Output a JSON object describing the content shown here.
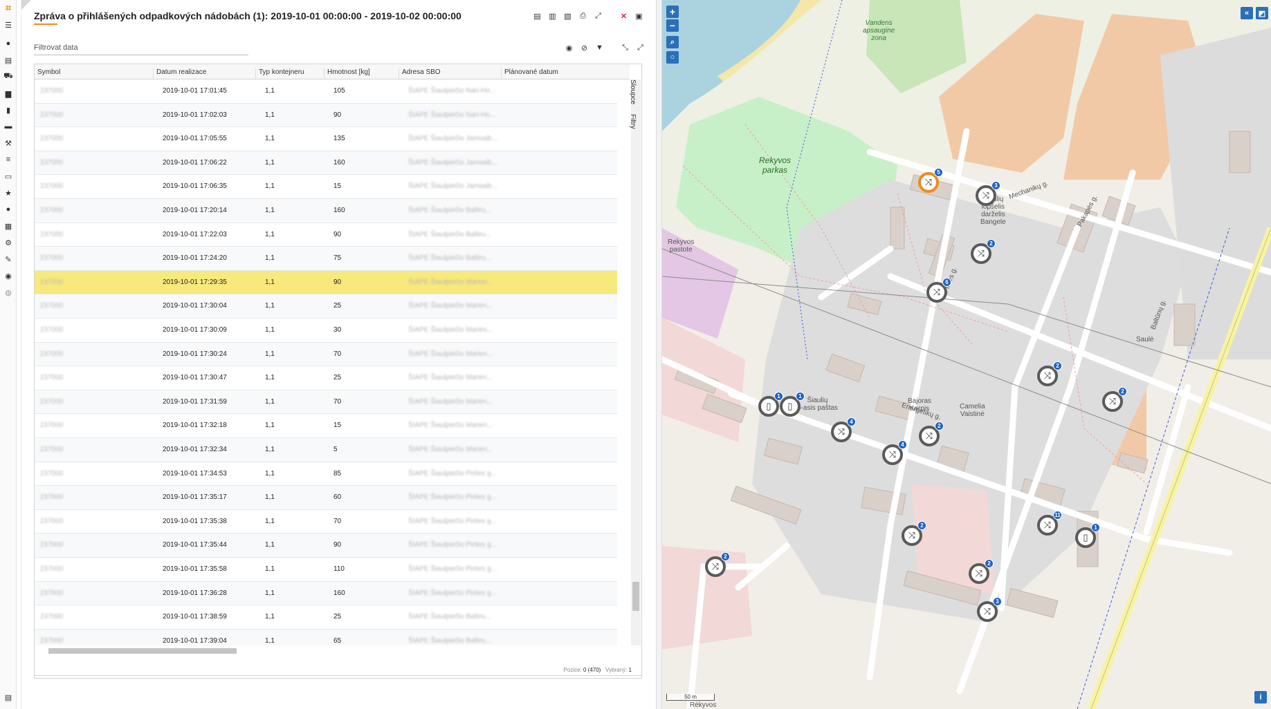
{
  "report": {
    "title": "Zpráva o přihlášených odpadkových nádobách (1): 2019-10-01 00:00:00 - 2019-10-02 00:00:00",
    "filter_placeholder": "Filtrovat data",
    "columns": [
      "Symbol",
      "Datum realizace",
      "Typ kontejneru",
      "Hmotnost [kg]",
      "Adresa SBO",
      "Plánované datum"
    ],
    "rows": [
      {
        "symbol": "237000",
        "date": "2019-10-01 17:01:45",
        "type": "1,1",
        "weight": "105",
        "address": "ŠIAPE Šiaulpiečio Nari-Ho...",
        "selected": false
      },
      {
        "symbol": "237000",
        "date": "2019-10-01 17:02:03",
        "type": "1,1",
        "weight": "90",
        "address": "ŠIAPE Šiaulpiečio Nari-Ho...",
        "selected": false
      },
      {
        "symbol": "237000",
        "date": "2019-10-01 17:05:55",
        "type": "1,1",
        "weight": "135",
        "address": "ŠIAPE Šiaulpiečio Jamsaib...",
        "selected": false
      },
      {
        "symbol": "237000",
        "date": "2019-10-01 17:06:22",
        "type": "1,1",
        "weight": "160",
        "address": "ŠIAPE Šiaulpiečio Jamsaib...",
        "selected": false
      },
      {
        "symbol": "237000",
        "date": "2019-10-01 17:06:35",
        "type": "1,1",
        "weight": "15",
        "address": "ŠIAPE Šiaulpiečio Jamsaib...",
        "selected": false
      },
      {
        "symbol": "237000",
        "date": "2019-10-01 17:20:14",
        "type": "1,1",
        "weight": "160",
        "address": "ŠIAPE Šiaulpiečio Baltiru...",
        "selected": false
      },
      {
        "symbol": "237000",
        "date": "2019-10-01 17:22:03",
        "type": "1,1",
        "weight": "90",
        "address": "ŠIAPE Šiaulpiečio Baltiru...",
        "selected": false
      },
      {
        "symbol": "237000",
        "date": "2019-10-01 17:24:20",
        "type": "1,1",
        "weight": "75",
        "address": "ŠIAPE Šiaulpiečio Baltiru...",
        "selected": false
      },
      {
        "symbol": "237000",
        "date": "2019-10-01 17:29:35",
        "type": "1,1",
        "weight": "90",
        "address": "ŠIAPE Šiaulpiečio Marien...",
        "selected": true
      },
      {
        "symbol": "237000",
        "date": "2019-10-01 17:30:04",
        "type": "1,1",
        "weight": "25",
        "address": "ŠIAPE Šiaulpiečio Marien...",
        "selected": false
      },
      {
        "symbol": "237000",
        "date": "2019-10-01 17:30:09",
        "type": "1,1",
        "weight": "30",
        "address": "ŠIAPE Šiaulpiečio Marien...",
        "selected": false
      },
      {
        "symbol": "237000",
        "date": "2019-10-01 17:30:24",
        "type": "1,1",
        "weight": "70",
        "address": "ŠIAPE Šiaulpiečio Marien...",
        "selected": false
      },
      {
        "symbol": "237000",
        "date": "2019-10-01 17:30:47",
        "type": "1,1",
        "weight": "25",
        "address": "ŠIAPE Šiaulpiečio Marien...",
        "selected": false
      },
      {
        "symbol": "237000",
        "date": "2019-10-01 17:31:59",
        "type": "1,1",
        "weight": "70",
        "address": "ŠIAPE Šiaulpiečio Marien...",
        "selected": false
      },
      {
        "symbol": "237000",
        "date": "2019-10-01 17:32:18",
        "type": "1,1",
        "weight": "15",
        "address": "ŠIAPE Šiaulpiečio Marien...",
        "selected": false
      },
      {
        "symbol": "237000",
        "date": "2019-10-01 17:32:34",
        "type": "1,1",
        "weight": "5",
        "address": "ŠIAPE Šiaulpiečio Marien...",
        "selected": false
      },
      {
        "symbol": "237000",
        "date": "2019-10-01 17:34:53",
        "type": "1,1",
        "weight": "85",
        "address": "ŠIAPE Šiaulpiečio Pirties g...",
        "selected": false
      },
      {
        "symbol": "237000",
        "date": "2019-10-01 17:35:17",
        "type": "1,1",
        "weight": "60",
        "address": "ŠIAPE Šiaulpiečio Pirties g...",
        "selected": false
      },
      {
        "symbol": "237000",
        "date": "2019-10-01 17:35:38",
        "type": "1,1",
        "weight": "70",
        "address": "ŠIAPE Šiaulpiečio Pirties g...",
        "selected": false
      },
      {
        "symbol": "237000",
        "date": "2019-10-01 17:35:44",
        "type": "1,1",
        "weight": "90",
        "address": "ŠIAPE Šiaulpiečio Pirties g...",
        "selected": false
      },
      {
        "symbol": "237000",
        "date": "2019-10-01 17:35:58",
        "type": "1,1",
        "weight": "110",
        "address": "ŠIAPE Šiaulpiečio Pirties g...",
        "selected": false
      },
      {
        "symbol": "237000",
        "date": "2019-10-01 17:36:28",
        "type": "1,1",
        "weight": "160",
        "address": "ŠIAPE Šiaulpiečio Pirties g...",
        "selected": false
      },
      {
        "symbol": "237000",
        "date": "2019-10-01 17:38:59",
        "type": "1,1",
        "weight": "25",
        "address": "ŠIAPE Šiaulpiečio Baltiru...",
        "selected": false
      },
      {
        "symbol": "237000",
        "date": "2019-10-01 17:39:04",
        "type": "1,1",
        "weight": "65",
        "address": "ŠIAPE Šiaulpiečio Baltiru...",
        "selected": false
      }
    ],
    "side_tabs": [
      "Sloupce",
      "Filtry"
    ],
    "footer": {
      "position_label": "Pozice:",
      "position_value": "0 (470)",
      "selected_label": "Vybraný:",
      "selected_value": "1"
    }
  },
  "map": {
    "labels": [
      {
        "text": "Vandens\napsaugine\nzona"
      },
      {
        "text": "Rekyvos\nparkas"
      },
      {
        "text": "Rekyvos\npastote"
      },
      {
        "text": "Mechanikų g."
      },
      {
        "text": "Pakapės g."
      },
      {
        "text": "Pirties g."
      },
      {
        "text": "Energetikų g."
      },
      {
        "text": "Baltūnų g."
      },
      {
        "text": "Šiaulių\nlopšelis\ndarželis\nBangele"
      },
      {
        "text": "Šiaulių\n5-asis paštas"
      },
      {
        "text": "Bajoras\nKarpis"
      },
      {
        "text": "Camelia\nVaistinė"
      },
      {
        "text": "Saulė"
      },
      {
        "text": "Rėkyvos"
      }
    ],
    "markers": [
      {
        "icon": "shuffle-icon",
        "count": "5",
        "active": true
      },
      {
        "icon": "shuffle-icon",
        "count": "3"
      },
      {
        "icon": "shuffle-icon",
        "count": "2"
      },
      {
        "icon": "shuffle-icon",
        "count": "6"
      },
      {
        "icon": "shuffle-icon",
        "count": "2"
      },
      {
        "icon": "shuffle-icon",
        "count": "2"
      },
      {
        "icon": "trash-icon",
        "count": "1"
      },
      {
        "icon": "trash-icon",
        "count": "1"
      },
      {
        "icon": "shuffle-icon",
        "count": "4"
      },
      {
        "icon": "shuffle-icon",
        "count": "4"
      },
      {
        "icon": "shuffle-icon",
        "count": "2"
      },
      {
        "icon": "shuffle-icon",
        "count": "11"
      },
      {
        "icon": "trash-icon",
        "count": "1"
      },
      {
        "icon": "shuffle-icon",
        "count": "2"
      },
      {
        "icon": "shuffle-icon",
        "count": "2"
      },
      {
        "icon": "shuffle-icon",
        "count": "2"
      },
      {
        "icon": "shuffle-icon",
        "count": "3"
      }
    ],
    "scale_label": "50 m",
    "colors": {
      "park": "#c8f0c8",
      "water": "#aad3df",
      "industrial": "#f2c9a6",
      "buildings": "#d9d0c9",
      "residential": "#dddddd",
      "marker_badge": "#1e63c4",
      "accent": "#f08a1c"
    }
  }
}
